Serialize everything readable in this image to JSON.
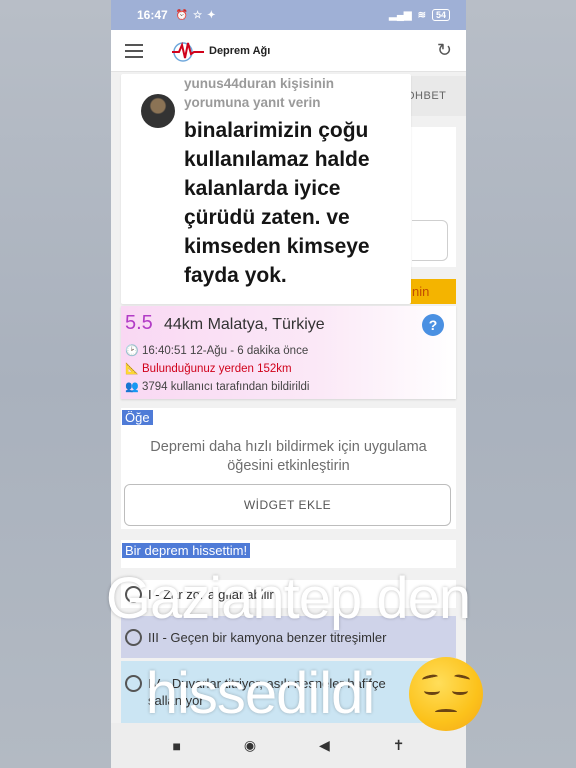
{
  "statusbar": {
    "time": "16:47",
    "icons": [
      "alarm-icon",
      "star-icon",
      "sparkle-icon"
    ],
    "battery": "54"
  },
  "appbar": {
    "title": "Deprem Ağı"
  },
  "tabs": {
    "sohbet": "ОHBET"
  },
  "comment": {
    "header": "yunus44duran kişisinin yorumuna yanıt verin",
    "body": "binalarimizin çoğu kullanılamaz halde kalanlarda iyice çürüdü zaten. ve kimseden kimseye fayda yok."
  },
  "orange_strip": {
    "text": "nin"
  },
  "quake": {
    "magnitude": "5.5",
    "place": "44km Malatya, Türkiye",
    "time": "16:40:51 12-Ağu - 6 dakika önce",
    "distance": "Bulunduğunuz yerden 152km",
    "reports": "3794 kullanıcı tarafından bildirildi",
    "colors": {
      "magnitude": "#b23cc6",
      "distance": "#d0021b"
    }
  },
  "widget": {
    "title": "Öğe",
    "description": "Depremi daha hızlı bildirmek için uygulama öğesini etkinleştirin",
    "button": "WİDGET EKLE"
  },
  "felt": {
    "title": "Bir deprem hissettim!",
    "options": [
      "I - Zar zor algılanabilir",
      "III - Geçen bir kamyona benzer titreşimler",
      "IV - Duvarlar titriyor, asılı nesneler hafifçe sallanıyor"
    ]
  },
  "caption": {
    "line1": "Gaziantep den",
    "line2": "hissedildi"
  }
}
